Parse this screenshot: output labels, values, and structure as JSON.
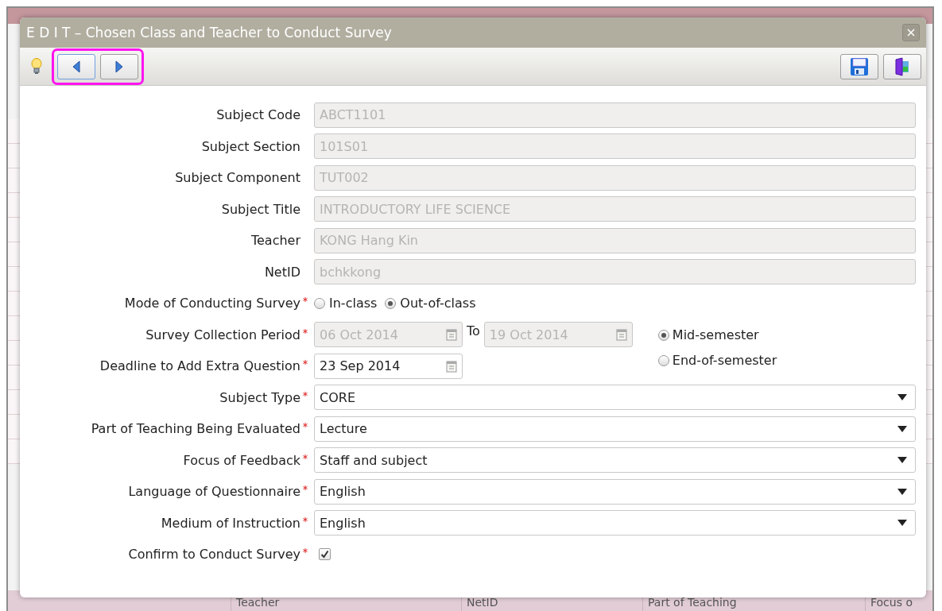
{
  "window": {
    "title": "E D I T – Chosen Class and Teacher to Conduct Survey"
  },
  "toolbar": {
    "highlighted": true
  },
  "form": [
    {
      "kind": "text",
      "label": "Subject Code",
      "required": false,
      "value": "ABCT1101",
      "disabled": true
    },
    {
      "kind": "text",
      "label": "Subject Section",
      "required": false,
      "value": "101S01",
      "disabled": true
    },
    {
      "kind": "text",
      "label": "Subject Component",
      "required": false,
      "value": "TUT002",
      "disabled": true
    },
    {
      "kind": "text",
      "label": "Subject Title",
      "required": false,
      "value": "INTRODUCTORY LIFE SCIENCE",
      "disabled": true
    },
    {
      "kind": "text",
      "label": "Teacher",
      "required": false,
      "value": "KONG Hang Kin",
      "disabled": true
    },
    {
      "kind": "text",
      "label": "NetID",
      "required": false,
      "value": "bchkkong",
      "disabled": true
    },
    {
      "kind": "radio",
      "label": "Mode of Conducting Survey",
      "required": true,
      "options": [
        {
          "label": "In-class",
          "selected": false
        },
        {
          "label": "Out-of-class",
          "selected": true
        }
      ]
    },
    {
      "kind": "daterange",
      "label": "Survey Collection Period",
      "required": true,
      "from": "06 Oct 2014",
      "to": "19 Oct 2014",
      "separator": "To",
      "disabled": true,
      "options": [
        {
          "label": "Mid-semester",
          "selected": true
        },
        {
          "label": "End-of-semester",
          "selected": false
        }
      ]
    },
    {
      "kind": "date",
      "label": "Deadline to Add Extra Question",
      "required": true,
      "value": "23 Sep 2014",
      "disabled": false
    },
    {
      "kind": "select",
      "label": "Subject Type",
      "required": true,
      "value": "CORE"
    },
    {
      "kind": "select",
      "label": "Part of Teaching Being Evaluated",
      "required": true,
      "value": "Lecture"
    },
    {
      "kind": "select",
      "label": "Focus of Feedback",
      "required": true,
      "value": "Staff and subject"
    },
    {
      "kind": "select",
      "label": "Language of Questionnaire",
      "required": true,
      "value": "English"
    },
    {
      "kind": "select",
      "label": "Medium of Instruction",
      "required": true,
      "value": "English"
    },
    {
      "kind": "checkbox",
      "label": "Confirm to Conduct Survey",
      "required": true,
      "checked": true
    }
  ],
  "background_table": {
    "columns": [
      "Teacher",
      "NetID",
      "Part of Teaching",
      "Focus o"
    ]
  }
}
